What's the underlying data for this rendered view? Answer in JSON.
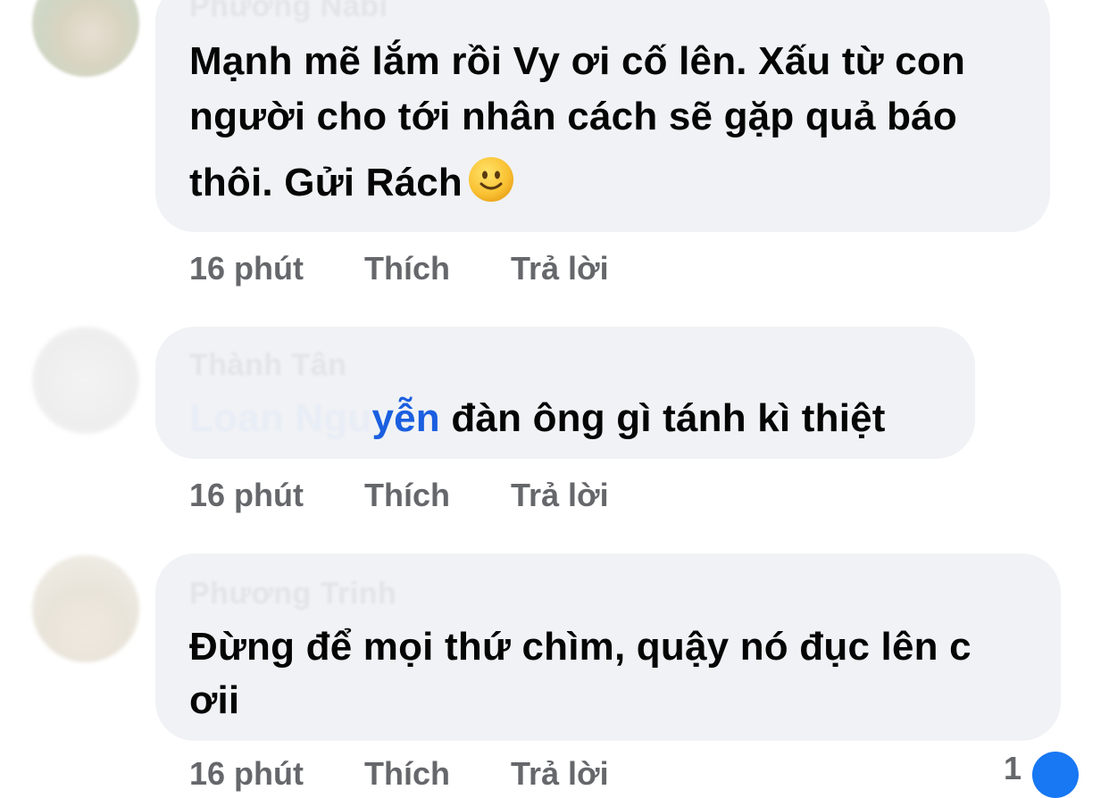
{
  "comments": [
    {
      "author": "Phương Nabi",
      "text_lines": [
        "Mạnh mẽ lắm rồi Vy ơi cố lên. Xấu từ con",
        "người cho tới nhân cách sẽ gặp quả báo",
        "thôi. Gửi Rách"
      ],
      "emoji": "slightly-smiling-face-icon",
      "time": "16 phút",
      "like_label": "Thích",
      "reply_label": "Trả lời"
    },
    {
      "author": "Thành Tân",
      "mention_faded": "Loan Ngu",
      "mention_visible": "yễn",
      "text": " đàn ông gì tánh kì thiệt",
      "time": "16 phút",
      "like_label": "Thích",
      "reply_label": "Trả lời"
    },
    {
      "author": "Phương Trinh",
      "text_lines": [
        "Đừng để mọi thứ chìm, quậy nó đục lên c",
        "ơii"
      ],
      "time": "16 phút",
      "like_label": "Thích",
      "reply_label": "Trả lời",
      "reaction_count": "1"
    }
  ],
  "colors": {
    "bubble": "#f0f2f5",
    "text": "#050505",
    "meta": "#65676b",
    "mention": "#1b5fe0",
    "like_badge": "#1877f2"
  }
}
